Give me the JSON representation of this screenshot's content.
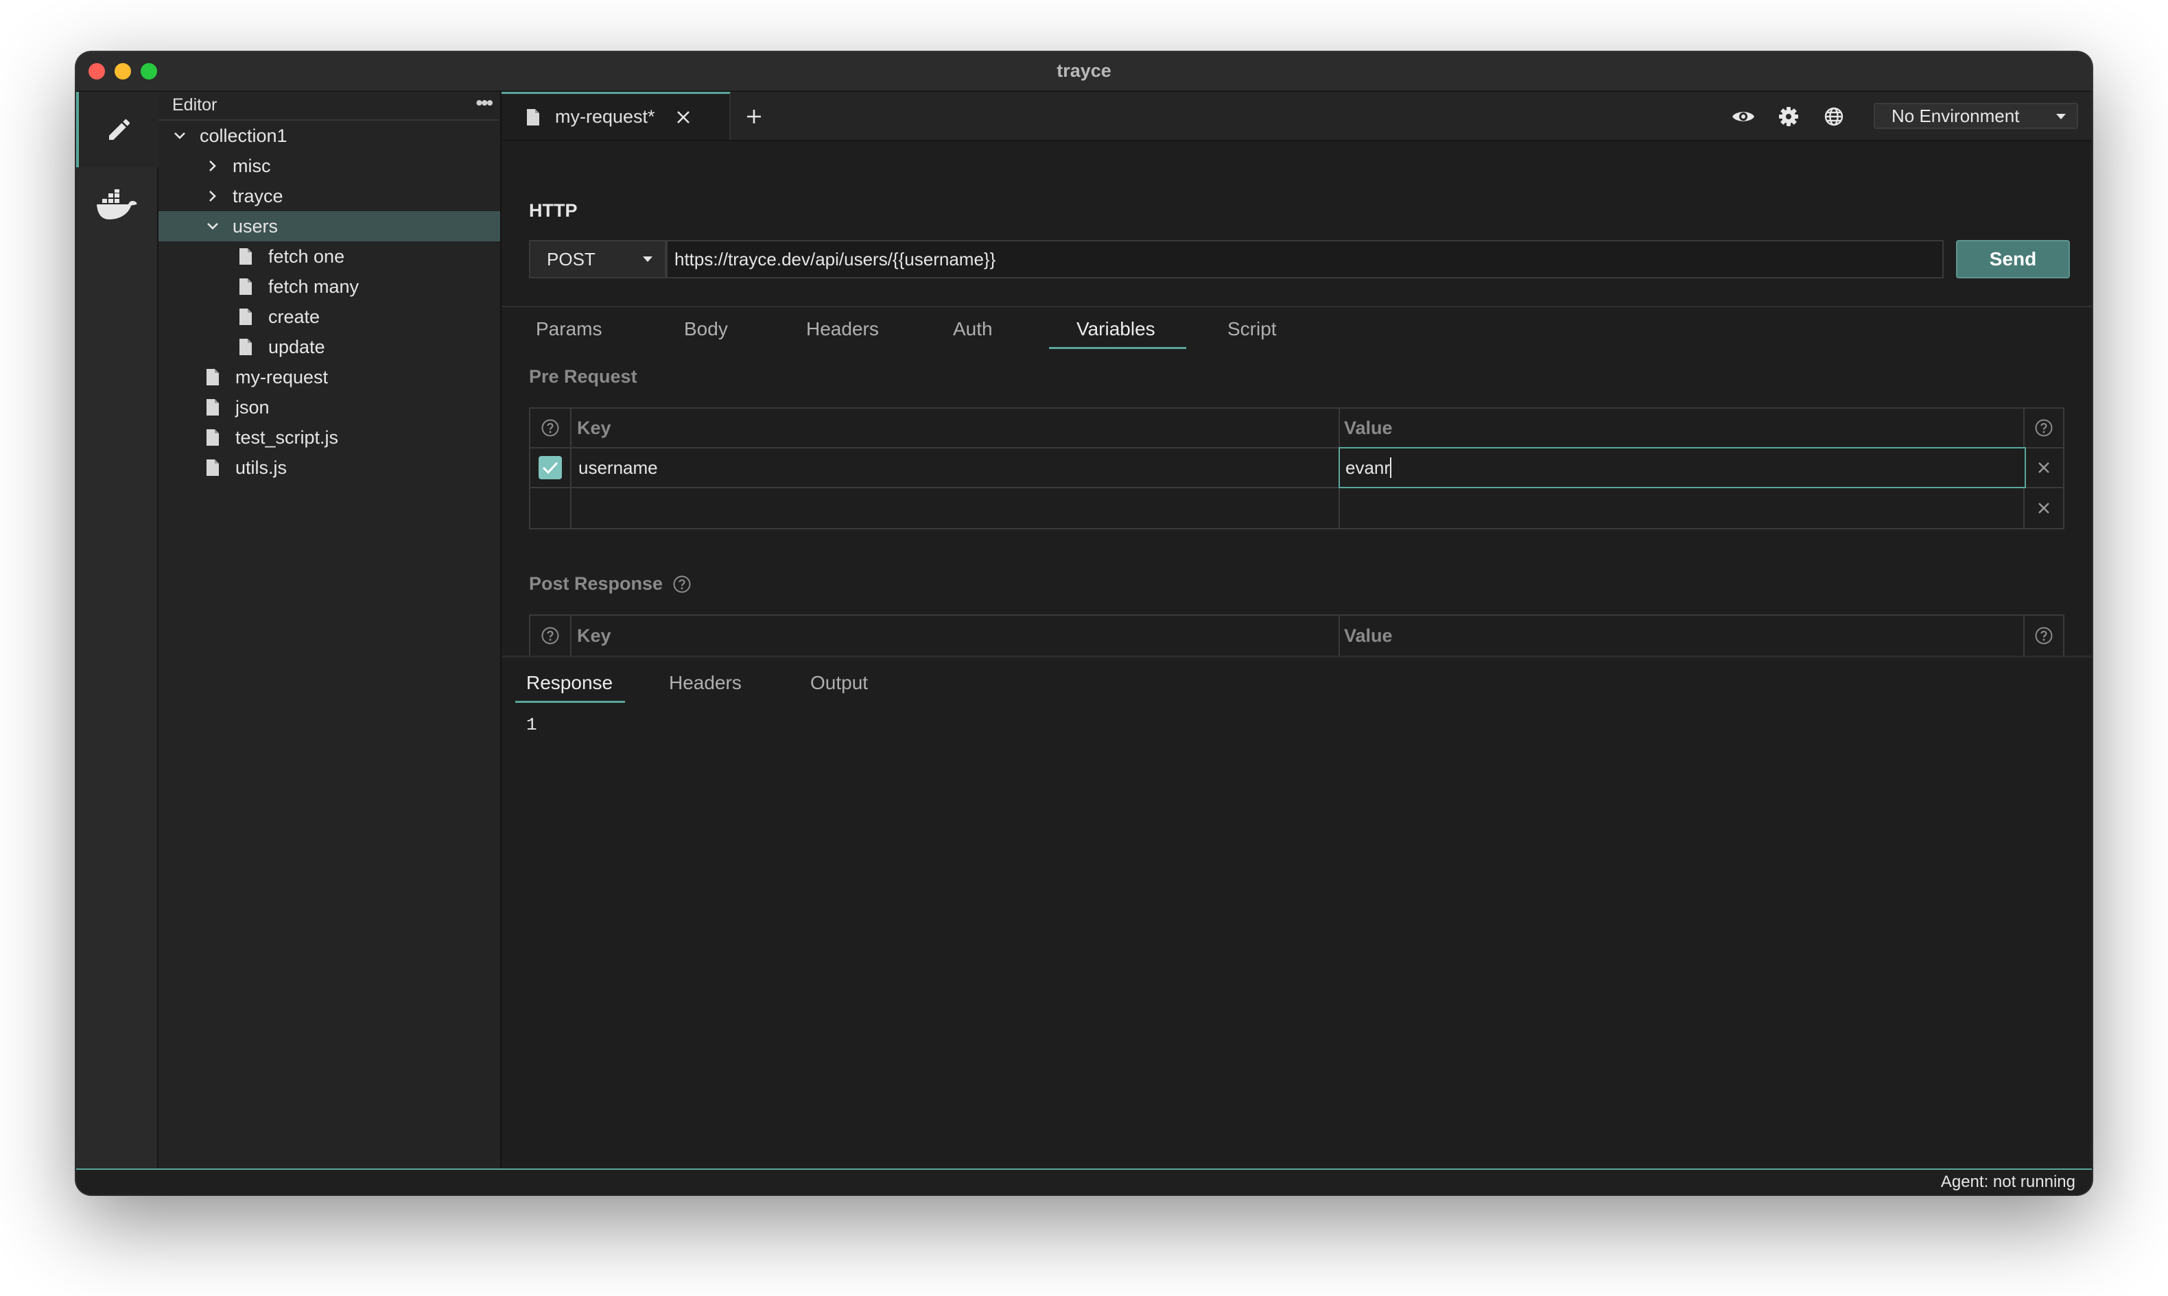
{
  "window": {
    "title": "trayce"
  },
  "sidebar": {
    "title": "Editor",
    "tree": [
      {
        "label": "collection1",
        "type": "folder",
        "expanded": true,
        "depth": 0
      },
      {
        "label": "misc",
        "type": "folder",
        "expanded": false,
        "depth": 1
      },
      {
        "label": "trayce",
        "type": "folder",
        "expanded": false,
        "depth": 1
      },
      {
        "label": "users",
        "type": "folder",
        "expanded": true,
        "depth": 1,
        "selected": true
      },
      {
        "label": "fetch one",
        "type": "file",
        "depth": 2
      },
      {
        "label": "fetch many",
        "type": "file",
        "depth": 2
      },
      {
        "label": "create",
        "type": "file",
        "depth": 2
      },
      {
        "label": "update",
        "type": "file",
        "depth": 2
      },
      {
        "label": "my-request",
        "type": "file",
        "depth": 1
      },
      {
        "label": "json",
        "type": "file",
        "depth": 1
      },
      {
        "label": "test_script.js",
        "type": "file",
        "depth": 1
      },
      {
        "label": "utils.js",
        "type": "file",
        "depth": 1
      }
    ]
  },
  "tabs": [
    {
      "label": "my-request*"
    }
  ],
  "toolbar": {
    "environment": "No Environment"
  },
  "request": {
    "section_title": "HTTP",
    "method": "POST",
    "url": "https://trayce.dev/api/users/{{username}}",
    "send_label": "Send"
  },
  "request_tabs": [
    "Params",
    "Body",
    "Headers",
    "Auth",
    "Variables",
    "Script"
  ],
  "active_request_tab": "Variables",
  "variables": {
    "pre_request_label": "Pre Request",
    "post_response_label": "Post Response",
    "key_header": "Key",
    "value_header": "Value",
    "pre_request_rows": [
      {
        "enabled": true,
        "key": "username",
        "value": "evanr"
      }
    ]
  },
  "response_tabs": [
    "Response",
    "Headers",
    "Output"
  ],
  "active_response_tab": "Response",
  "response": {
    "line_number": "1"
  },
  "status": {
    "agent": "Agent: not running"
  },
  "colors": {
    "accent": "#5aa79a",
    "selected_row": "#3d5352",
    "send_button": "#4a7c77"
  }
}
